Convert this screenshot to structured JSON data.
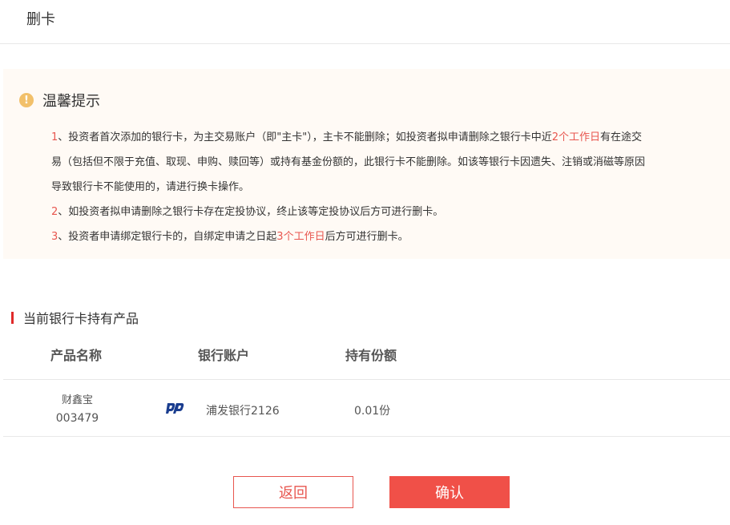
{
  "header": {
    "title": "删卡"
  },
  "notice": {
    "title": "温馨提示",
    "icon": "exclamation-icon",
    "items": [
      {
        "num": "1",
        "pre": "、投资者首次添加的银行卡，为主交易账户（即\"主卡\"），主卡不能删除；如投资者拟申请删除之银行卡中近",
        "highlight": "2个工作日",
        "post": "有在途交",
        "line2": "易（包括但不限于充值、取现、申购、赎回等）或持有基金份额的，此银行卡不能删除。如该等银行卡因遗失、注销或消磁等原因",
        "line3": "导致银行卡不能使用的，请进行换卡操作。"
      },
      {
        "num": "2",
        "text": "、如投资者拟申请删除之银行卡存在定投协议，终止该等定投协议后方可进行删卡。"
      },
      {
        "num": "3",
        "pre": "、投资者申请绑定银行卡的，自绑定申请之日起",
        "highlight": "3个工作日",
        "post": "后方可进行删卡。"
      }
    ]
  },
  "section": {
    "title": "当前银行卡持有产品"
  },
  "table": {
    "headers": [
      "产品名称",
      "银行账户",
      "持有份额"
    ],
    "rows": [
      {
        "product_name": "财鑫宝",
        "product_code": "003479",
        "bank_icon": "spdb-bank-logo",
        "bank_account": "浦发银行2126",
        "shares": "0.01份"
      }
    ]
  },
  "buttons": {
    "back": "返回",
    "confirm": "确认"
  },
  "colors": {
    "accent": "#f05048",
    "highlight_text": "#e8564f",
    "notice_bg": "#fffaf5",
    "warn_icon": "#f2c06a",
    "section_bar": "#e02a2a",
    "bank_logo": "#1a3d8f"
  }
}
